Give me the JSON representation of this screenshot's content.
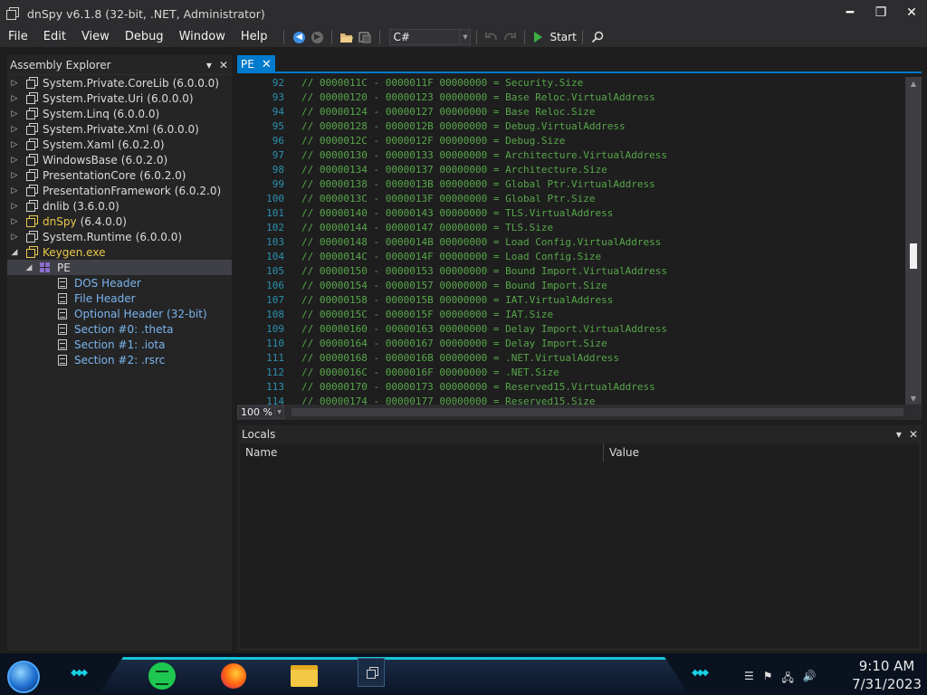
{
  "window": {
    "title": "dnSpy v6.1.8 (32-bit, .NET, Administrator)",
    "minimize_glyph": "━",
    "maximize_glyph": "❐",
    "close_glyph": "✕"
  },
  "menu": [
    "File",
    "Edit",
    "View",
    "Debug",
    "Window",
    "Help"
  ],
  "toolbar": {
    "language": "C#",
    "start_label": "Start"
  },
  "assembly_explorer": {
    "title": "Assembly Explorer",
    "items": [
      {
        "name": "System.Private.CoreLib",
        "version": "(6.0.0.0)"
      },
      {
        "name": "System.Private.Uri",
        "version": "(6.0.0.0)"
      },
      {
        "name": "System.Linq",
        "version": "(6.0.0.0)"
      },
      {
        "name": "System.Private.Xml",
        "version": "(6.0.0.0)"
      },
      {
        "name": "System.Xaml",
        "version": "(6.0.2.0)"
      },
      {
        "name": "WindowsBase",
        "version": "(6.0.2.0)"
      },
      {
        "name": "PresentationCore",
        "version": "(6.0.2.0)"
      },
      {
        "name": "PresentationFramework",
        "version": "(6.0.2.0)"
      },
      {
        "name": "dnlib",
        "version": "(3.6.0.0)"
      },
      {
        "name": "dnSpy",
        "version": "(6.4.0.0)"
      },
      {
        "name": "System.Runtime",
        "version": "(6.0.0.0)"
      }
    ],
    "keygen": "Keygen.exe",
    "pe": "PE",
    "pe_children": [
      "DOS Header",
      "File Header",
      "Optional Header (32-bit)",
      "Section #0: .theta",
      "Section #1: .iota",
      "Section #2: .rsrc"
    ]
  },
  "editor": {
    "tab_label": "PE",
    "zoom": "100 %",
    "lines": [
      {
        "n": "92",
        "text": "// 0000011C - 0000011F 00000000 = Security.Size"
      },
      {
        "n": "93",
        "text": "// 00000120 - 00000123 00000000 = Base Reloc.VirtualAddress"
      },
      {
        "n": "94",
        "text": "// 00000124 - 00000127 00000000 = Base Reloc.Size"
      },
      {
        "n": "95",
        "text": "// 00000128 - 0000012B 00000000 = Debug.VirtualAddress"
      },
      {
        "n": "96",
        "text": "// 0000012C - 0000012F 00000000 = Debug.Size"
      },
      {
        "n": "97",
        "text": "// 00000130 - 00000133 00000000 = Architecture.VirtualAddress"
      },
      {
        "n": "98",
        "text": "// 00000134 - 00000137 00000000 = Architecture.Size"
      },
      {
        "n": "99",
        "text": "// 00000138 - 0000013B 00000000 = Global Ptr.VirtualAddress"
      },
      {
        "n": "100",
        "text": "// 0000013C - 0000013F 00000000 = Global Ptr.Size"
      },
      {
        "n": "101",
        "text": "// 00000140 - 00000143 00000000 = TLS.VirtualAddress"
      },
      {
        "n": "102",
        "text": "// 00000144 - 00000147 00000000 = TLS.Size"
      },
      {
        "n": "103",
        "text": "// 00000148 - 0000014B 00000000 = Load Config.VirtualAddress"
      },
      {
        "n": "104",
        "text": "// 0000014C - 0000014F 00000000 = Load Config.Size"
      },
      {
        "n": "105",
        "text": "// 00000150 - 00000153 00000000 = Bound Import.VirtualAddress"
      },
      {
        "n": "106",
        "text": "// 00000154 - 00000157 00000000 = Bound Import.Size"
      },
      {
        "n": "107",
        "text": "// 00000158 - 0000015B 00000000 = IAT.VirtualAddress"
      },
      {
        "n": "108",
        "text": "// 0000015C - 0000015F 00000000 = IAT.Size"
      },
      {
        "n": "109",
        "text": "// 00000160 - 00000163 00000000 = Delay Import.VirtualAddress"
      },
      {
        "n": "110",
        "text": "// 00000164 - 00000167 00000000 = Delay Import.Size"
      },
      {
        "n": "111",
        "text": "// 00000168 - 0000016B 00000000 = .NET.VirtualAddress"
      },
      {
        "n": "112",
        "text": "// 0000016C - 0000016F 00000000 = .NET.Size"
      },
      {
        "n": "113",
        "text": "// 00000170 - 00000173 00000000 = Reserved15.VirtualAddress"
      },
      {
        "n": "114",
        "text": "// 00000174 - 00000177 00000000 = Reserved15.Size"
      }
    ]
  },
  "locals": {
    "title": "Locals",
    "col_name": "Name",
    "col_value": "Value"
  },
  "taskbar": {
    "time": "9:10 AM",
    "date": "7/31/2023"
  }
}
